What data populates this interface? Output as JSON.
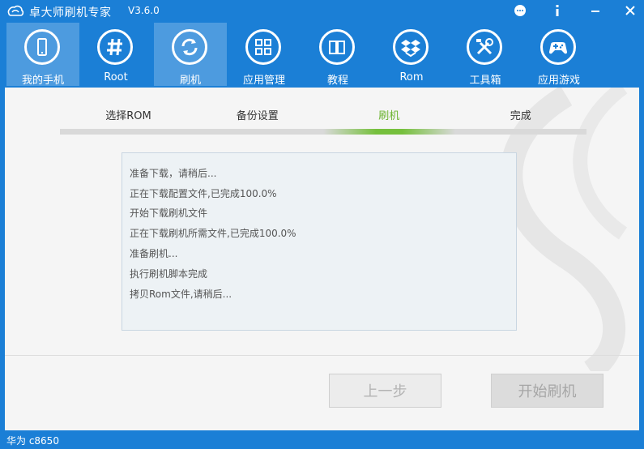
{
  "window": {
    "title": "卓大师刷机专家",
    "version": "V3.6.0",
    "icons": [
      "logo-icon",
      "message-icon",
      "info-icon",
      "minimize-icon",
      "close-icon"
    ]
  },
  "nav": {
    "items": [
      {
        "label": "我的手机",
        "icon": "phone-icon",
        "active": true
      },
      {
        "label": "Root",
        "icon": "hash-icon",
        "active": false
      },
      {
        "label": "刷机",
        "icon": "refresh-icon",
        "active": true
      },
      {
        "label": "应用管理",
        "icon": "apps-grid-icon",
        "active": false
      },
      {
        "label": "教程",
        "icon": "book-icon",
        "active": false
      },
      {
        "label": "Rom",
        "icon": "box-icon",
        "active": false
      },
      {
        "label": "工具箱",
        "icon": "tools-icon",
        "active": false
      },
      {
        "label": "应用游戏",
        "icon": "gamepad-icon",
        "active": false
      }
    ]
  },
  "steps": {
    "labels": [
      "选择ROM",
      "备份设置",
      "刷机",
      "完成"
    ],
    "current_index": 2
  },
  "log": {
    "lines": [
      "准备下载，请稍后...",
      "正在下载配置文件,已完成100.0%",
      "开始下载刷机文件",
      "正在下载刷机所需文件,已完成100.0%",
      "准备刷机...",
      "执行刷机脚本完成",
      "拷贝Rom文件,请稍后..."
    ]
  },
  "buttons": {
    "back": "上一步",
    "start": "开始刷机"
  },
  "status": {
    "device": "华为 c8650"
  },
  "colors": {
    "primary": "#1b7fd6",
    "accent_green": "#76c03d",
    "content_bg": "#f5f5f5"
  }
}
